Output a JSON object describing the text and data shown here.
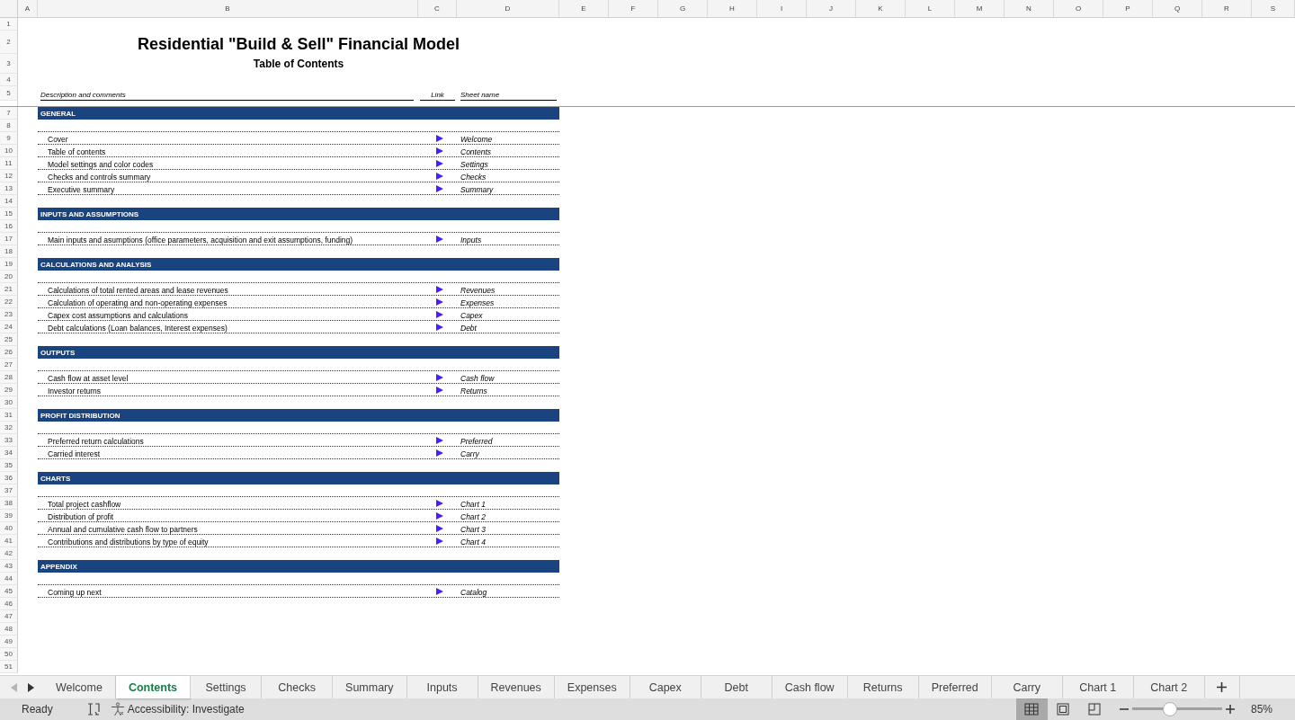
{
  "column_headers": [
    "A",
    "B",
    "C",
    "D",
    "E",
    "F",
    "G",
    "H",
    "I",
    "J",
    "K",
    "L",
    "M",
    "N",
    "O",
    "P",
    "Q",
    "R",
    "S"
  ],
  "rows": [
    {
      "number": "1",
      "kind": "blank"
    },
    {
      "number": "2",
      "kind": "title",
      "text": "Residential \"Build & Sell\" Financial Model"
    },
    {
      "number": "3",
      "kind": "subtitle",
      "text": "Table of Contents"
    },
    {
      "number": "4",
      "kind": "blank"
    },
    {
      "number": "5",
      "kind": "headings",
      "description": "Description and comments",
      "link": "Link",
      "sheet": "Sheet name"
    },
    {
      "kind": "spacer"
    },
    {
      "number": "7",
      "kind": "section",
      "text": "GENERAL"
    },
    {
      "number": "8",
      "kind": "rule"
    },
    {
      "number": "9",
      "kind": "item",
      "text": "Cover",
      "sheet": "Welcome"
    },
    {
      "number": "10",
      "kind": "item",
      "text": "Table of contents",
      "sheet": "Contents"
    },
    {
      "number": "11",
      "kind": "item",
      "text": "Model settings and color codes",
      "sheet": "Settings"
    },
    {
      "number": "12",
      "kind": "item",
      "text": "Checks and controls summary",
      "sheet": "Checks"
    },
    {
      "number": "13",
      "kind": "item",
      "text": "Executive summary",
      "sheet": "Summary"
    },
    {
      "number": "14",
      "kind": "blank"
    },
    {
      "number": "15",
      "kind": "section",
      "text": "INPUTS AND ASSUMPTIONS"
    },
    {
      "number": "16",
      "kind": "rule"
    },
    {
      "number": "17",
      "kind": "item",
      "text": "Main inputs and asumptions (office parameters, acquisition and exit assumptions, funding)",
      "sheet": "Inputs"
    },
    {
      "number": "18",
      "kind": "blank"
    },
    {
      "number": "19",
      "kind": "section",
      "text": "CALCULATIONS AND ANALYSIS"
    },
    {
      "number": "20",
      "kind": "rule"
    },
    {
      "number": "21",
      "kind": "item",
      "text": "Calculations of total rented areas and lease revenues",
      "sheet": "Revenues"
    },
    {
      "number": "22",
      "kind": "item",
      "text": "Calculation of operating and non-operating expenses",
      "sheet": "Expenses"
    },
    {
      "number": "23",
      "kind": "item",
      "text": "Capex cost assumptions and calculations",
      "sheet": "Capex"
    },
    {
      "number": "24",
      "kind": "item",
      "text": "Debt calculations (Loan balances, Interest expenses)",
      "sheet": "Debt"
    },
    {
      "number": "25",
      "kind": "blank"
    },
    {
      "number": "26",
      "kind": "section",
      "text": "OUTPUTS"
    },
    {
      "number": "27",
      "kind": "rule"
    },
    {
      "number": "28",
      "kind": "item",
      "text": "Cash flow at asset level",
      "sheet": "Cash flow"
    },
    {
      "number": "29",
      "kind": "item",
      "text": "Investor returns",
      "sheet": "Returns"
    },
    {
      "number": "30",
      "kind": "blank"
    },
    {
      "number": "31",
      "kind": "section",
      "text": "PROFIT DISTRIBUTION"
    },
    {
      "number": "32",
      "kind": "rule"
    },
    {
      "number": "33",
      "kind": "item",
      "text": "Preferred return calculations",
      "sheet": "Preferred"
    },
    {
      "number": "34",
      "kind": "item",
      "text": "Carried interest",
      "sheet": "Carry"
    },
    {
      "number": "35",
      "kind": "blank"
    },
    {
      "number": "36",
      "kind": "section",
      "text": "CHARTS"
    },
    {
      "number": "37",
      "kind": "rule"
    },
    {
      "number": "38",
      "kind": "item",
      "text": "Total project cashflow",
      "sheet": "Chart 1"
    },
    {
      "number": "39",
      "kind": "item",
      "text": "Distribution of profit",
      "sheet": "Chart 2"
    },
    {
      "number": "40",
      "kind": "item",
      "text": "Annual and cumulative cash flow to partners",
      "sheet": "Chart 3"
    },
    {
      "number": "41",
      "kind": "item",
      "text": "Contributions and distributions by type of equity",
      "sheet": "Chart 4"
    },
    {
      "number": "42",
      "kind": "blank"
    },
    {
      "number": "43",
      "kind": "section",
      "text": "APPENDIX"
    },
    {
      "number": "44",
      "kind": "rule"
    },
    {
      "number": "45",
      "kind": "item",
      "text": "Coming up next",
      "sheet": "Catalog"
    },
    {
      "number": "46",
      "kind": "blank"
    },
    {
      "number": "47",
      "kind": "blank"
    },
    {
      "number": "48",
      "kind": "blank"
    },
    {
      "number": "49",
      "kind": "blank"
    },
    {
      "number": "50",
      "kind": "blank"
    },
    {
      "number": "51",
      "kind": "blank"
    }
  ],
  "tabs": [
    {
      "label": "Welcome",
      "selected": false
    },
    {
      "label": "Contents",
      "selected": true
    },
    {
      "label": "Settings",
      "selected": false
    },
    {
      "label": "Checks",
      "selected": false
    },
    {
      "label": "Summary",
      "selected": false
    },
    {
      "label": "Inputs",
      "selected": false
    },
    {
      "label": "Revenues",
      "selected": false
    },
    {
      "label": "Expenses",
      "selected": false
    },
    {
      "label": "Capex",
      "selected": false
    },
    {
      "label": "Debt",
      "selected": false
    },
    {
      "label": "Cash flow",
      "selected": false
    },
    {
      "label": "Returns",
      "selected": false
    },
    {
      "label": "Preferred",
      "selected": false
    },
    {
      "label": "Carry",
      "selected": false
    },
    {
      "label": "Chart 1",
      "selected": false
    },
    {
      "label": "Chart 2",
      "selected": false
    }
  ],
  "status_bar": {
    "status": "Ready",
    "accessibility": "Accessibility: Investigate",
    "views": [
      {
        "kind": "normal",
        "selected": true
      },
      {
        "kind": "page-layout",
        "selected": false
      },
      {
        "kind": "page-break",
        "selected": false
      }
    ],
    "zoom": {
      "level": 0.42,
      "value": "85%"
    }
  }
}
